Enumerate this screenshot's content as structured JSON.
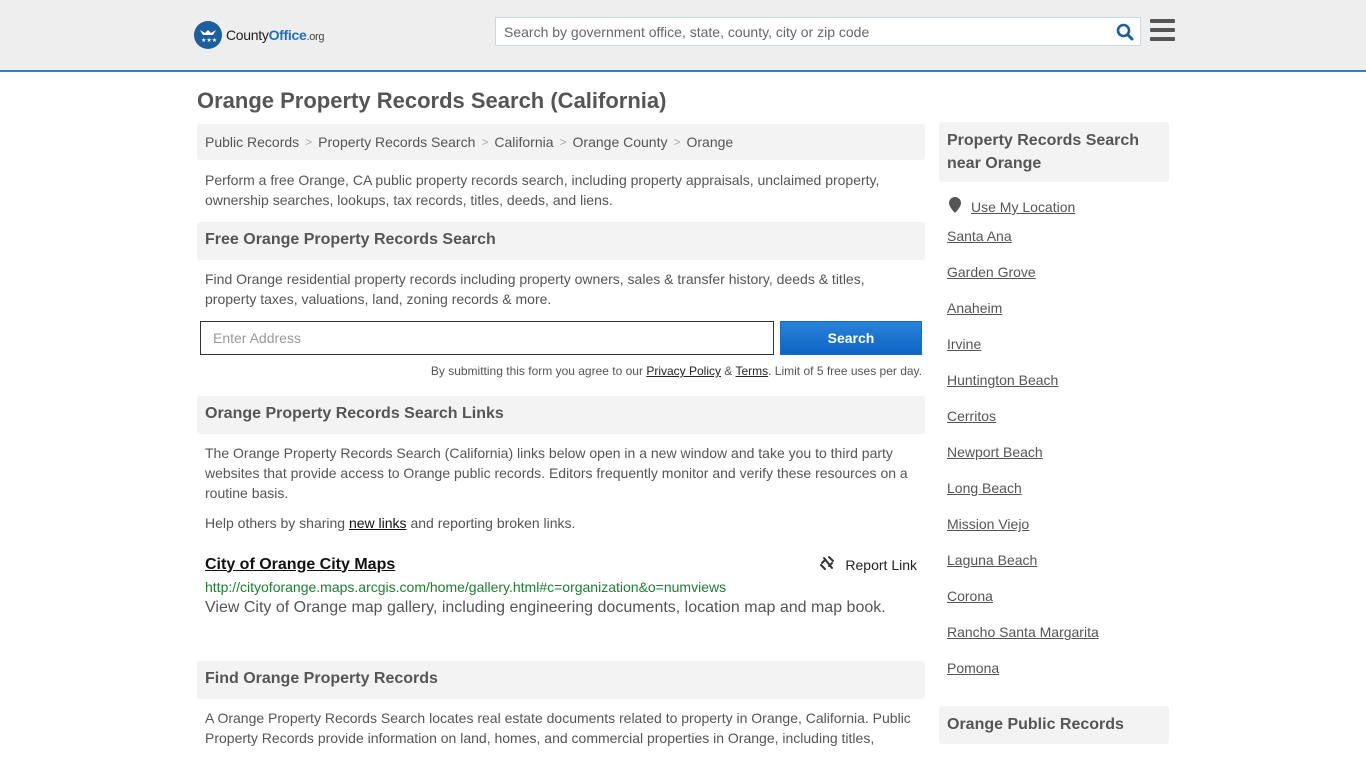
{
  "header": {
    "logo_main": "County",
    "logo_office": "Office",
    "logo_tld": ".org",
    "search_placeholder": "Search by government office, state, county, city or zip code",
    "accent_color": "#3a7fba"
  },
  "page_title": "Orange Property Records Search (California)",
  "breadcrumb": [
    "Public Records",
    "Property Records Search",
    "California",
    "Orange County",
    "Orange"
  ],
  "intro": "Perform a free Orange, CA public property records search, including property appraisals, unclaimed property, ownership searches, lookups, tax records, titles, deeds, and liens.",
  "free_search": {
    "heading": "Free Orange Property Records Search",
    "description": "Find Orange residential property records including property owners, sales & transfer history, deeds & titles, property taxes, valuations, land, zoning records & more.",
    "address_placeholder": "Enter Address",
    "button_label": "Search",
    "disclaimer_prefix": "By submitting this form you agree to our ",
    "privacy_label": "Privacy Policy",
    "amp": " & ",
    "terms_label": "Terms",
    "disclaimer_suffix": ". Limit of 5 free uses per day."
  },
  "links_section": {
    "heading": "Orange Property Records Search Links",
    "description": "The Orange Property Records Search (California) links below open in a new window and take you to third party websites that provide access to Orange public records. Editors frequently monitor and verify these resources on a routine basis.",
    "help_prefix": "Help others by sharing ",
    "help_link": "new links",
    "help_suffix": " and reporting broken links.",
    "items": [
      {
        "title": "City of Orange City Maps",
        "report_label": "Report Link",
        "url": "http://cityoforange.maps.arcgis.com/home/gallery.html#c=organization&o=numviews",
        "description": "View City of Orange map gallery, including engineering documents, location map and map book."
      }
    ]
  },
  "find_section": {
    "heading": "Find Orange Property Records",
    "description": "A Orange Property Records Search locates real estate documents related to property in Orange, California. Public Property Records provide information on land, homes, and commercial properties in Orange, including titles,"
  },
  "sidebar": {
    "heading": "Property Records Search near Orange",
    "use_location": "Use My Location",
    "cities": [
      "Santa Ana",
      "Garden Grove",
      "Anaheim",
      "Irvine",
      "Huntington Beach",
      "Cerritos",
      "Newport Beach",
      "Long Beach",
      "Mission Viejo",
      "Laguna Beach",
      "Corona",
      "Rancho Santa Margarita",
      "Pomona"
    ],
    "heading2": "Orange Public Records"
  }
}
